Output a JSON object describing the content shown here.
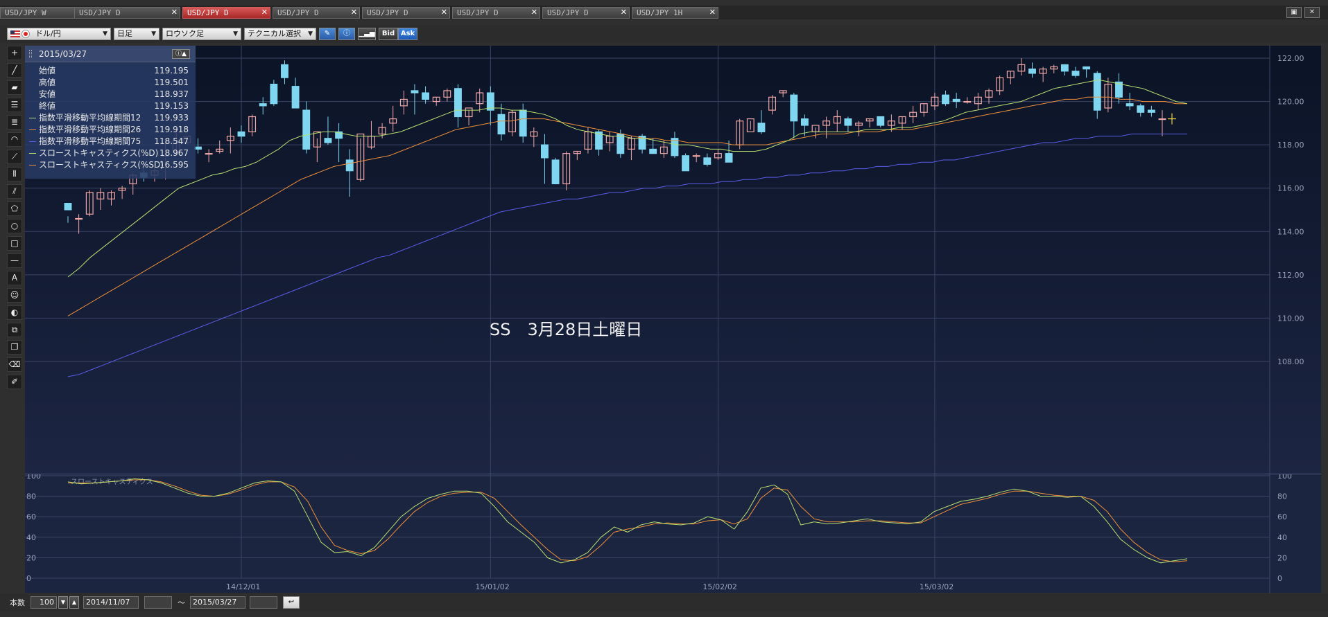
{
  "tabs": [
    {
      "label": "USD/JPY W",
      "active": false
    },
    {
      "label": "USD/JPY D",
      "active": false
    },
    {
      "label": "USD/JPY D",
      "active": true
    },
    {
      "label": "USD/JPY D",
      "active": false
    },
    {
      "label": "USD/JPY D",
      "active": false
    },
    {
      "label": "USD/JPY D",
      "active": false
    },
    {
      "label": "USD/JPY D",
      "active": false
    },
    {
      "label": "USD/JPY 1H",
      "active": false
    }
  ],
  "tab_close": "✕",
  "window_buttons": [
    "▣",
    "✕"
  ],
  "toolbar": {
    "currency": "ドル/円",
    "timeframe": "日足",
    "chart_type": "ロウソク足",
    "technical": "テクニカル選択",
    "bid": "Bid",
    "ask": "Ask"
  },
  "left_tools": [
    "crosshair-icon",
    "line-icon",
    "ruler-icon",
    "horizontal-lines-icon",
    "parallel-lines-icon",
    "arc-icon",
    "fan-icon",
    "vertical-lines-icon",
    "pitchfork-icon",
    "pentagon-icon",
    "circle-icon",
    "rectangle-icon",
    "hline-icon",
    "text-icon",
    "smiley-icon",
    "tool-a-icon",
    "copy-icon",
    "layers-icon",
    "eraser-icon",
    "eraser-all-icon"
  ],
  "info_panel": {
    "date": "2015/03/27",
    "open_label": "始値",
    "open": "119.195",
    "high_label": "高値",
    "high": "119.501",
    "low_label": "安値",
    "low": "118.937",
    "close_label": "終値",
    "close": "119.153",
    "ema12_label": "指数平滑移動平均線期間12",
    "ema12": "119.933",
    "ema26_label": "指数平滑移動平均線期間26",
    "ema26": "119.918",
    "ema75_label": "指数平滑移動平均線期間75",
    "ema75": "118.547",
    "stoch_k_label": "スローストキャスティクス(%D)",
    "stoch_k": "18.967",
    "stoch_d_label": "スローストキャスティクス(%SD)",
    "stoch_d": "16.595"
  },
  "colors": {
    "ema12": "#b8e070",
    "ema26": "#f0903a",
    "ema75": "#5a5ce8",
    "up": "#f0a8a8",
    "down": "#7fd6f0"
  },
  "annotation": "SS　3月28日土曜日",
  "sub_label": "スローストキャスティクス",
  "chart_data": {
    "type": "candlestick",
    "y_ticks": [
      "122.00",
      "120.00",
      "118.00",
      "116.00",
      "114.00",
      "112.00",
      "110.00",
      "108.00"
    ],
    "ylim": [
      106.8,
      122.5
    ],
    "x_ticks": [
      "14/12/01",
      "15/01/02",
      "15/02/02",
      "15/03/02"
    ],
    "x_tick_index": [
      16,
      39,
      60,
      80
    ],
    "candles": [
      [
        115.3,
        114.4,
        114.7,
        115.0
      ],
      [
        114.6,
        113.9,
        114.8,
        114.6
      ],
      [
        114.8,
        114.7,
        115.9,
        115.8
      ],
      [
        115.5,
        115.0,
        116.0,
        115.8
      ],
      [
        115.5,
        115.2,
        115.9,
        115.8
      ],
      [
        115.9,
        115.5,
        116.1,
        116.0
      ],
      [
        116.2,
        115.7,
        116.7,
        116.6
      ],
      [
        116.7,
        116.3,
        117.1,
        116.5
      ],
      [
        116.6,
        116.3,
        117.0,
        116.8
      ],
      [
        117.5,
        116.4,
        118.2,
        117.5
      ],
      [
        117.7,
        117.6,
        118.7,
        118.2
      ],
      [
        118.1,
        118.0,
        118.4,
        118.4
      ],
      [
        117.9,
        117.6,
        118.3,
        117.8
      ],
      [
        117.6,
        117.2,
        117.8,
        117.6
      ],
      [
        117.7,
        117.6,
        118.2,
        117.8
      ],
      [
        118.2,
        117.6,
        118.8,
        118.4
      ],
      [
        118.6,
        118.1,
        118.9,
        118.4
      ],
      [
        118.6,
        118.4,
        119.4,
        119.3
      ],
      [
        119.9,
        119.4,
        120.2,
        119.8
      ],
      [
        120.8,
        119.8,
        121.0,
        119.9
      ],
      [
        121.7,
        120.8,
        121.9,
        121.1
      ],
      [
        120.7,
        119.9,
        121.1,
        119.7
      ],
      [
        119.6,
        117.6,
        120.0,
        117.8
      ],
      [
        117.9,
        117.2,
        118.3,
        118.6
      ],
      [
        118.3,
        118.0,
        119.3,
        118.1
      ],
      [
        118.6,
        117.2,
        119.0,
        118.3
      ],
      [
        117.3,
        115.6,
        117.8,
        116.8
      ],
      [
        116.4,
        116.3,
        118.3,
        118.5
      ],
      [
        117.9,
        117.8,
        119.1,
        118.4
      ],
      [
        118.5,
        118.3,
        119.0,
        118.8
      ],
      [
        119.0,
        118.6,
        119.8,
        119.2
      ],
      [
        119.8,
        119.4,
        120.5,
        120.1
      ],
      [
        120.5,
        119.4,
        120.8,
        120.4
      ],
      [
        120.4,
        119.9,
        120.7,
        120.1
      ],
      [
        120.0,
        119.8,
        120.2,
        120.2
      ],
      [
        120.2,
        120.0,
        120.6,
        120.5
      ],
      [
        120.6,
        118.8,
        120.8,
        119.3
      ],
      [
        119.3,
        118.9,
        119.6,
        119.7
      ],
      [
        119.9,
        119.5,
        120.6,
        120.4
      ],
      [
        120.4,
        118.9,
        120.7,
        119.6
      ],
      [
        119.4,
        118.2,
        119.9,
        118.5
      ],
      [
        118.6,
        118.4,
        119.6,
        119.5
      ],
      [
        119.6,
        118.1,
        119.9,
        118.4
      ],
      [
        118.4,
        117.9,
        118.8,
        118.6
      ],
      [
        118.0,
        116.2,
        118.5,
        117.4
      ],
      [
        117.3,
        116.2,
        117.4,
        116.2
      ],
      [
        116.2,
        115.9,
        117.7,
        117.6
      ],
      [
        117.6,
        117.3,
        117.7,
        117.7
      ],
      [
        117.8,
        117.6,
        118.8,
        118.6
      ],
      [
        118.6,
        117.5,
        118.7,
        117.8
      ],
      [
        118.1,
        117.7,
        118.6,
        118.4
      ],
      [
        118.5,
        117.4,
        118.7,
        117.6
      ],
      [
        117.8,
        117.3,
        118.4,
        118.3
      ],
      [
        118.4,
        117.6,
        118.5,
        117.8
      ],
      [
        117.8,
        117.6,
        118.3,
        117.6
      ],
      [
        117.6,
        117.4,
        118.2,
        117.9
      ],
      [
        118.3,
        117.4,
        118.6,
        117.5
      ],
      [
        117.5,
        116.9,
        117.6,
        116.8
      ],
      [
        117.5,
        117.2,
        117.6,
        117.5
      ],
      [
        117.4,
        117.0,
        117.6,
        117.1
      ],
      [
        117.4,
        117.3,
        117.8,
        117.6
      ],
      [
        117.6,
        117.3,
        118.2,
        117.2
      ],
      [
        118.0,
        117.8,
        119.2,
        119.1
      ],
      [
        118.6,
        118.7,
        119.1,
        119.2
      ],
      [
        119.0,
        118.5,
        119.6,
        118.6
      ],
      [
        119.6,
        119.4,
        120.3,
        120.2
      ],
      [
        120.4,
        120.2,
        120.5,
        120.5
      ],
      [
        120.3,
        118.3,
        120.4,
        119.1
      ],
      [
        119.2,
        118.4,
        119.4,
        118.9
      ],
      [
        118.6,
        118.3,
        118.8,
        118.9
      ],
      [
        118.9,
        118.3,
        119.3,
        119.1
      ],
      [
        119.0,
        118.6,
        119.6,
        119.3
      ],
      [
        119.2,
        118.6,
        119.3,
        118.9
      ],
      [
        118.9,
        118.4,
        119.1,
        119.0
      ],
      [
        119.1,
        118.8,
        119.2,
        119.2
      ],
      [
        119.3,
        118.8,
        119.3,
        118.9
      ],
      [
        118.9,
        118.6,
        119.4,
        119.1
      ],
      [
        119.0,
        118.7,
        119.3,
        119.3
      ],
      [
        119.3,
        119.0,
        119.8,
        119.5
      ],
      [
        119.5,
        119.3,
        119.9,
        119.9
      ],
      [
        119.8,
        119.6,
        120.4,
        120.2
      ],
      [
        120.3,
        119.8,
        120.5,
        119.9
      ],
      [
        120.1,
        119.7,
        120.4,
        120.0
      ],
      [
        120.0,
        119.9,
        120.2,
        120.0
      ],
      [
        119.9,
        119.6,
        120.4,
        120.2
      ],
      [
        120.2,
        119.9,
        120.6,
        120.5
      ],
      [
        120.5,
        120.3,
        121.2,
        121.1
      ],
      [
        121.1,
        120.8,
        121.4,
        121.4
      ],
      [
        121.4,
        121.2,
        122.0,
        121.7
      ],
      [
        121.5,
        121.1,
        121.8,
        121.3
      ],
      [
        121.3,
        120.9,
        121.6,
        121.5
      ],
      [
        121.5,
        121.3,
        121.7,
        121.6
      ],
      [
        121.7,
        121.2,
        121.7,
        121.4
      ],
      [
        121.4,
        121.1,
        121.6,
        121.2
      ],
      [
        121.6,
        121.1,
        121.6,
        121.5
      ],
      [
        121.3,
        119.2,
        121.4,
        119.6
      ],
      [
        119.7,
        119.5,
        121.1,
        120.8
      ],
      [
        120.9,
        119.9,
        121.3,
        120.2
      ],
      [
        119.9,
        119.6,
        120.4,
        119.8
      ],
      [
        119.8,
        119.3,
        119.9,
        119.5
      ],
      [
        119.6,
        119.3,
        119.8,
        119.5
      ],
      [
        119.2,
        118.4,
        119.6,
        119.2
      ]
    ],
    "ema12": [
      111.9,
      112.3,
      112.8,
      113.2,
      113.6,
      114.0,
      114.4,
      114.8,
      115.2,
      115.6,
      116.0,
      116.2,
      116.4,
      116.6,
      116.7,
      116.9,
      117.0,
      117.2,
      117.5,
      117.8,
      118.2,
      118.4,
      118.5,
      118.6,
      118.6,
      118.5,
      118.4,
      118.4,
      118.4,
      118.5,
      118.6,
      118.8,
      119.0,
      119.2,
      119.4,
      119.6,
      119.6,
      119.6,
      119.7,
      119.7,
      119.6,
      119.6,
      119.5,
      119.4,
      119.2,
      118.9,
      118.7,
      118.6,
      118.5,
      118.4,
      118.4,
      118.3,
      118.3,
      118.2,
      118.1,
      118.0,
      118.0,
      117.9,
      117.8,
      117.8,
      117.7,
      117.7,
      117.7,
      117.8,
      118.0,
      118.2,
      118.5,
      118.6,
      118.6,
      118.6,
      118.6,
      118.6,
      118.7,
      118.7,
      118.7,
      118.8,
      118.8,
      118.9,
      119.0,
      119.1,
      119.3,
      119.5,
      119.6,
      119.7,
      119.8,
      119.9,
      120.0,
      120.2,
      120.4,
      120.6,
      120.7,
      120.8,
      120.9,
      121.0,
      120.9,
      120.8,
      120.7,
      120.6,
      120.4,
      120.2,
      120.0,
      119.9
    ],
    "ema26": [
      110.1,
      110.4,
      110.7,
      111.0,
      111.3,
      111.6,
      111.9,
      112.2,
      112.5,
      112.8,
      113.1,
      113.4,
      113.7,
      114.0,
      114.3,
      114.6,
      114.9,
      115.2,
      115.5,
      115.8,
      116.1,
      116.4,
      116.6,
      116.8,
      117.0,
      117.1,
      117.2,
      117.3,
      117.4,
      117.5,
      117.7,
      117.9,
      118.1,
      118.3,
      118.5,
      118.7,
      118.8,
      118.9,
      119.0,
      119.1,
      119.1,
      119.2,
      119.2,
      119.2,
      119.1,
      119.0,
      118.9,
      118.8,
      118.7,
      118.6,
      118.5,
      118.4,
      118.3,
      118.3,
      118.2,
      118.2,
      118.1,
      118.1,
      118.1,
      118.1,
      118.0,
      118.0,
      118.0,
      118.0,
      118.1,
      118.2,
      118.3,
      118.4,
      118.5,
      118.5,
      118.5,
      118.6,
      118.6,
      118.6,
      118.7,
      118.7,
      118.7,
      118.8,
      118.9,
      119.0,
      119.1,
      119.2,
      119.3,
      119.4,
      119.5,
      119.6,
      119.7,
      119.8,
      119.9,
      120.0,
      120.1,
      120.1,
      120.2,
      120.2,
      120.2,
      120.1,
      120.1,
      120.0,
      120.0,
      120.0,
      119.9,
      119.9
    ],
    "ema75": [
      107.3,
      107.4,
      107.6,
      107.8,
      108.0,
      108.2,
      108.4,
      108.6,
      108.8,
      109.0,
      109.2,
      109.4,
      109.6,
      109.8,
      110.0,
      110.2,
      110.4,
      110.6,
      110.8,
      111.0,
      111.2,
      111.4,
      111.6,
      111.8,
      112.0,
      112.2,
      112.4,
      112.6,
      112.8,
      112.9,
      113.1,
      113.3,
      113.5,
      113.7,
      113.9,
      114.1,
      114.3,
      114.5,
      114.7,
      114.9,
      115.0,
      115.1,
      115.2,
      115.3,
      115.4,
      115.5,
      115.5,
      115.6,
      115.7,
      115.8,
      115.8,
      115.9,
      116.0,
      116.0,
      116.1,
      116.1,
      116.2,
      116.2,
      116.2,
      116.3,
      116.3,
      116.4,
      116.4,
      116.5,
      116.5,
      116.6,
      116.6,
      116.7,
      116.7,
      116.8,
      116.8,
      116.9,
      116.9,
      117.0,
      117.0,
      117.1,
      117.1,
      117.2,
      117.2,
      117.3,
      117.3,
      117.4,
      117.5,
      117.6,
      117.7,
      117.8,
      117.9,
      118.0,
      118.1,
      118.1,
      118.2,
      118.3,
      118.3,
      118.4,
      118.4,
      118.4,
      118.5,
      118.5,
      118.5,
      118.5,
      118.5,
      118.5
    ],
    "sub_y_ticks": [
      "100",
      "80",
      "60",
      "40",
      "20",
      "0"
    ],
    "stoch_k": [
      94,
      92,
      93,
      94,
      95,
      97,
      96,
      93,
      88,
      83,
      80,
      80,
      83,
      88,
      93,
      95,
      94,
      85,
      60,
      35,
      25,
      26,
      22,
      30,
      45,
      60,
      70,
      78,
      82,
      85,
      85,
      83,
      70,
      55,
      45,
      35,
      20,
      15,
      18,
      25,
      40,
      50,
      45,
      52,
      55,
      53,
      52,
      54,
      60,
      57,
      48,
      65,
      88,
      91,
      82,
      52,
      55,
      53,
      54,
      56,
      58,
      55,
      54,
      53,
      55,
      65,
      70,
      75,
      77,
      80,
      84,
      87,
      85,
      80,
      80,
      79,
      80,
      70,
      55,
      38,
      28,
      20,
      15,
      17,
      19
    ],
    "stoch_d": [
      93,
      93,
      93,
      94,
      95,
      96,
      96,
      94,
      90,
      85,
      81,
      80,
      82,
      86,
      91,
      94,
      94,
      89,
      75,
      50,
      32,
      27,
      24,
      27,
      38,
      52,
      65,
      74,
      80,
      83,
      84,
      84,
      78,
      65,
      52,
      40,
      28,
      18,
      17,
      21,
      32,
      45,
      48,
      50,
      53,
      54,
      53,
      53,
      56,
      57,
      53,
      58,
      78,
      88,
      86,
      70,
      58,
      55,
      55,
      55,
      56,
      56,
      55,
      54,
      54,
      60,
      66,
      72,
      75,
      78,
      82,
      85,
      85,
      83,
      81,
      80,
      80,
      76,
      65,
      48,
      35,
      25,
      18,
      16,
      17
    ]
  }
}
